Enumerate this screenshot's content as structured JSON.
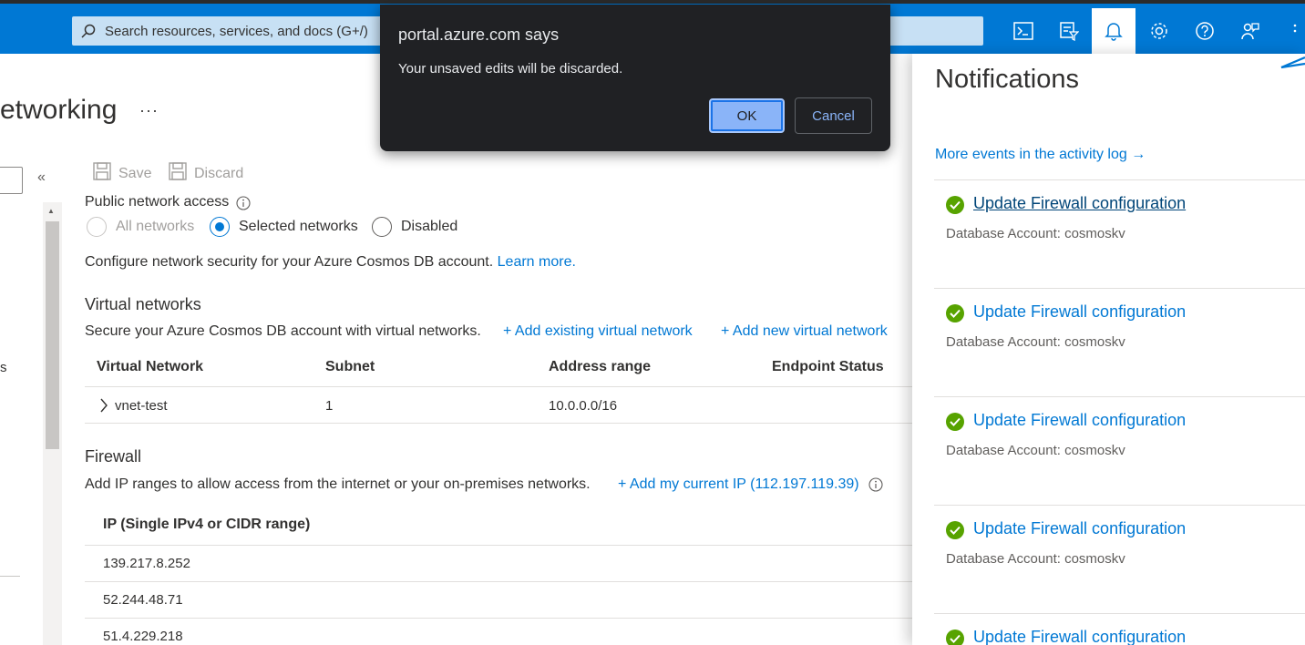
{
  "topbar": {
    "search_placeholder": "Search resources, services, and docs (G+/)",
    "icons": [
      "cloud-shell-icon",
      "directory-filter-icon",
      "notifications-icon",
      "settings-icon",
      "help-icon",
      "feedback-icon"
    ],
    "accent": "#0078d4"
  },
  "page": {
    "title": "etworking",
    "more": "···",
    "left_fragment": "s"
  },
  "toolbar": {
    "save_label": "Save",
    "discard_label": "Discard"
  },
  "public_access": {
    "label": "Public network access",
    "options": [
      "All networks",
      "Selected networks",
      "Disabled"
    ],
    "selected": "Selected networks",
    "description": "Configure network security for your Azure Cosmos DB account.",
    "learn_more": "Learn more."
  },
  "virtual_networks": {
    "heading": "Virtual networks",
    "description": "Secure your Azure Cosmos DB account with virtual networks.",
    "add_existing": "+ Add existing virtual network",
    "add_new": "+ Add new virtual network",
    "columns": [
      "Virtual Network",
      "Subnet",
      "Address range",
      "Endpoint Status"
    ],
    "rows": [
      {
        "name": "vnet-test",
        "subnet": "1",
        "address_range": "10.0.0.0/16",
        "endpoint_status": ""
      }
    ]
  },
  "firewall": {
    "heading": "Firewall",
    "description": "Add IP ranges to allow access from the internet or your on-premises networks.",
    "add_ip": "+ Add my current IP (112.197.119.39)",
    "column": "IP (Single IPv4 or CIDR range)",
    "ips": [
      "139.217.8.252",
      "52.244.48.71",
      "51.4.229.218"
    ]
  },
  "notifications": {
    "title": "Notifications",
    "activity_link": "More events in the activity log →",
    "items": [
      {
        "title": "Update Firewall configuration",
        "subtitle": "Database Account: cosmoskv"
      },
      {
        "title": "Update Firewall configuration",
        "subtitle": "Database Account: cosmoskv"
      },
      {
        "title": "Update Firewall configuration",
        "subtitle": "Database Account: cosmoskv"
      },
      {
        "title": "Update Firewall configuration",
        "subtitle": "Database Account: cosmoskv"
      },
      {
        "title": "Update Firewall configuration",
        "subtitle": ""
      }
    ],
    "success_color": "#57a300"
  },
  "dialog": {
    "title": "portal.azure.com says",
    "message": "Your unsaved edits will be discarded.",
    "ok_label": "OK",
    "cancel_label": "Cancel"
  }
}
